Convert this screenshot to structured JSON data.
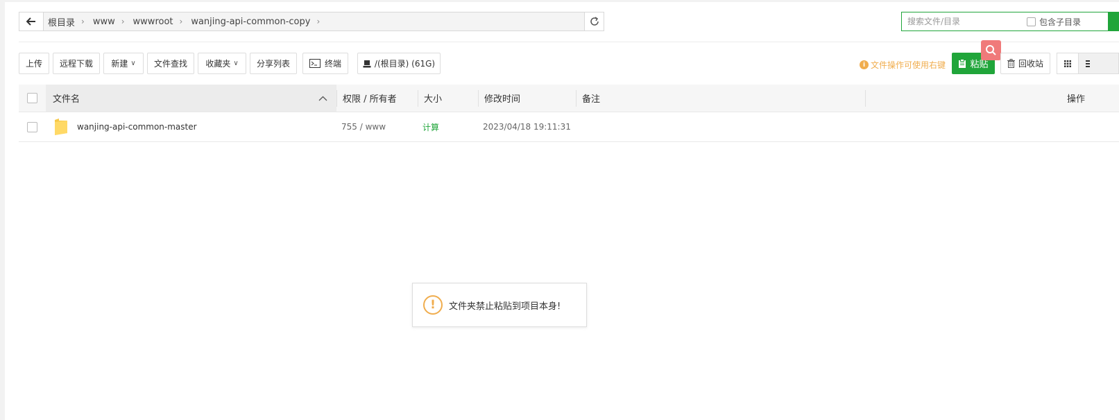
{
  "breadcrumb": {
    "items": [
      "根目录",
      "www",
      "wwwroot",
      "wanjing-api-common-copy"
    ]
  },
  "search": {
    "placeholder": "搜索文件/目录",
    "include_subdir_label": "包含子目录"
  },
  "toolbar": {
    "upload": "上传",
    "remote_download": "远程下载",
    "new": "新建",
    "file_search": "文件查找",
    "favorites": "收藏夹",
    "share_list": "分享列表",
    "terminal": "终端",
    "disk": "/(根目录) (61G)",
    "tip": "文件操作可使用右键",
    "paste": "粘贴",
    "recycle_bin": "回收站"
  },
  "table": {
    "headers": {
      "name": "文件名",
      "permission": "权限 / 所有者",
      "size": "大小",
      "modified": "修改时间",
      "note": "备注",
      "action": "操作"
    },
    "rows": [
      {
        "name": "wanjing-api-common-master",
        "permission": "755 / www",
        "size": "计算",
        "modified": "2023/04/18 19:11:31",
        "note": ""
      }
    ]
  },
  "toast": {
    "message": "文件夹禁止粘贴到项目本身!"
  },
  "colors": {
    "primary": "#20a53a",
    "warning": "#f0ad4e",
    "float_search": "#f07a7a"
  }
}
